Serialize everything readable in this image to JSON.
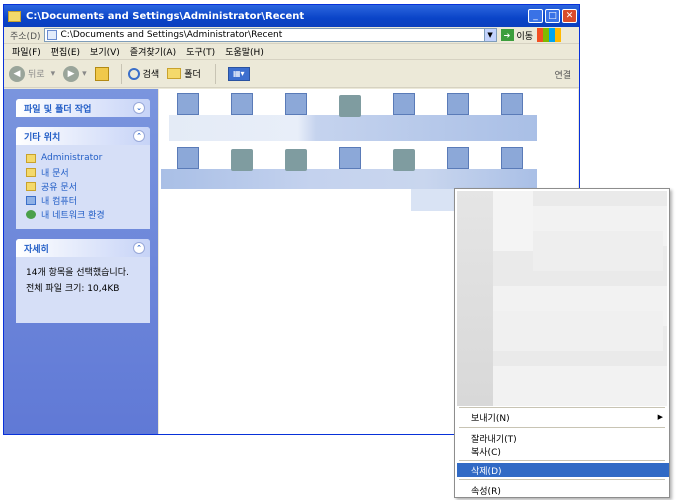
{
  "window": {
    "title": "C:\\Documents and Settings\\Administrator\\Recent"
  },
  "addressbar": {
    "label": "주소(D)",
    "path": "C:\\Documents and Settings\\Administrator\\Recent",
    "go_label": "이동"
  },
  "menubar": [
    {
      "label": "파일(F)"
    },
    {
      "label": "편집(E)"
    },
    {
      "label": "보기(V)"
    },
    {
      "label": "즐겨찾기(A)"
    },
    {
      "label": "도구(T)"
    },
    {
      "label": "도움말(H)"
    }
  ],
  "toolbar": {
    "back_label": "뒤로",
    "search_label": "검색",
    "folders_label": "폴더",
    "links_label": "연결"
  },
  "leftpane": {
    "tasks_title": "파일 및 폴더 작업",
    "other_title": "기타 위치",
    "other_items": [
      {
        "label": "Administrator",
        "icon": "folder-icon"
      },
      {
        "label": "내 문서",
        "icon": "folder-icon"
      },
      {
        "label": "공유 문서",
        "icon": "folder-icon"
      },
      {
        "label": "내 컴퓨터",
        "icon": "computer-icon"
      },
      {
        "label": "내 네트워크 환경",
        "icon": "network-icon"
      }
    ],
    "details_title": "자세히",
    "details_line1": "14개 항목을 선택했습니다.",
    "details_line2": "전체 파일 크기: 10,4KB"
  },
  "context_menu": {
    "items": [
      {
        "label": "보내기(N)",
        "has_submenu": true
      },
      {
        "label": "잘라내기(T)"
      },
      {
        "label": "복사(C)"
      },
      {
        "label": "삭제(D)",
        "selected": true
      },
      {
        "label": "속성(R)"
      }
    ]
  },
  "colors": {
    "titlebar": "#0a44c8",
    "task_pane": "#6f89db",
    "selection": "#316ac5"
  }
}
